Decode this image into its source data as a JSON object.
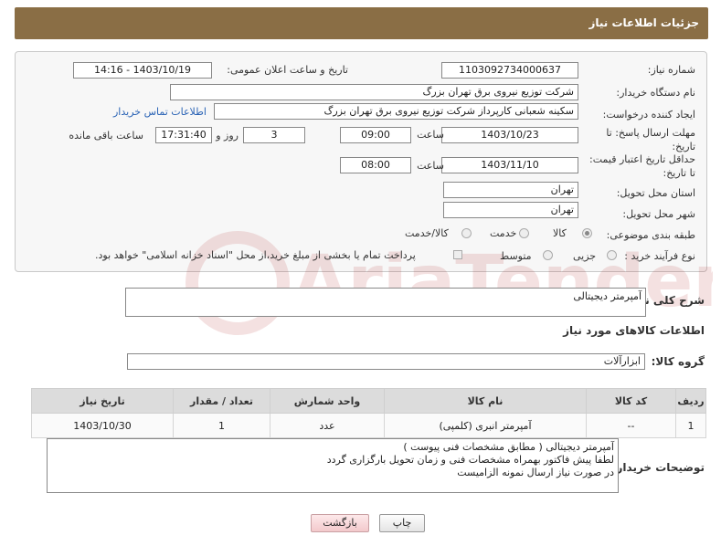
{
  "header": {
    "title": "جزئیات اطلاعات نیاز"
  },
  "form": {
    "need_number_label": "شماره نیاز:",
    "need_number": "1103092734000637",
    "announce_label": "تاریخ و ساعت اعلان عمومی:",
    "announce_value": "1403/10/19 - 14:16",
    "buyer_org_label": "نام دستگاه خریدار:",
    "buyer_org": "شرکت توزیع نیروی برق تهران بزرگ",
    "requester_label": "ایجاد کننده درخواست:",
    "requester": "سکینه شعبانی کارپرداز شرکت توزیع نیروی برق تهران بزرگ",
    "buyer_contact_link": "اطلاعات تماس خریدار",
    "reply_deadline_label": "مهلت ارسال پاسخ: تا تاریخ:",
    "reply_date": "1403/10/23",
    "time_label": "ساعت",
    "reply_time": "09:00",
    "days_value": "3",
    "days_label": "روز و",
    "remaining_time": "17:31:40",
    "remaining_label": "ساعت باقی مانده",
    "price_validity_label": "حداقل تاریخ اعتبار قیمت: تا تاریخ:",
    "validity_date": "1403/11/10",
    "validity_time": "08:00",
    "province_label": "استان محل تحویل:",
    "province": "تهران",
    "city_label": "شهر محل تحویل:",
    "city": "تهران",
    "category_label": "طبقه بندی موضوعی:",
    "category_options": [
      "کالا",
      "خدمت",
      "کالا/خدمت"
    ],
    "category_selected": "کالا",
    "process_label": "نوع فرآیند خرید :",
    "process_options": [
      "جزیی",
      "متوسط"
    ],
    "payment_note": "پرداخت تمام یا بخشی از مبلغ خرید،از محل \"اسناد خزانه اسلامی\" خواهد بود."
  },
  "summary": {
    "label": "شرح کلی نیاز:",
    "value": "آمپرمتر دیجیتالی"
  },
  "goods_section_title": "اطلاعات کالاهای مورد نیاز",
  "goods_group": {
    "label": "گروه کالا:",
    "value": "ابزارآلات"
  },
  "table": {
    "headers": [
      "ردیف",
      "کد کالا",
      "نام کالا",
      "واحد شمارش",
      "تعداد / مقدار",
      "تاریخ نیاز"
    ],
    "rows": [
      [
        "1",
        "--",
        "آمپرمتر انبری (کلمپی)",
        "عدد",
        "1",
        "1403/10/30"
      ]
    ]
  },
  "buyer_notes": {
    "label": "توضیحات خریدار:",
    "lines": [
      "آمپرمتر دیجیتالی  ( مطابق مشخصات فنی پیوست )",
      "لطفا پیش فاکتور بهمراه مشخصات فنی و زمان تحویل بارگزاری گردد",
      "در صورت نیاز ارسال نمونه الزامیست"
    ]
  },
  "buttons": {
    "print": "چاپ",
    "back": "بازگشت"
  },
  "watermark": {
    "text": "AriaTender.neT"
  }
}
